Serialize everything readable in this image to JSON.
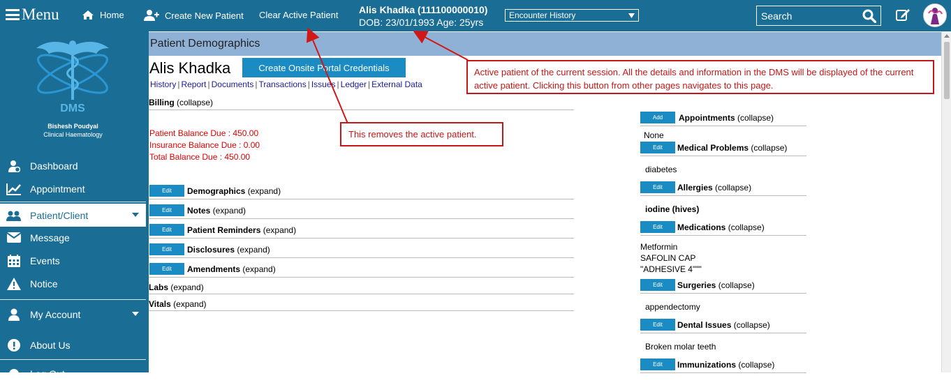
{
  "topbar": {
    "menu_label": "Menu",
    "home_label": "Home",
    "create_patient_label": "Create New Patient",
    "clear_patient_label": "Clear Active Patient",
    "patient_name": "Alis Khadka (111100000010)",
    "patient_dob_age": "DOB: 23/01/1993 Age: 25yrs",
    "encounter_select_value": "Encounter History",
    "search_placeholder": "Search",
    "colors": {
      "bar": "#1a6e95",
      "accent": "#1a8cc3"
    }
  },
  "sidebar": {
    "logo_text": "DMS",
    "doctor_name": "Bishesh Poudyal",
    "doctor_specialty": "Clinical Haematology",
    "items": [
      {
        "label": "Dashboard",
        "icon": "user-gauge-icon"
      },
      {
        "label": "Appointment",
        "icon": "line-chart-icon"
      },
      {
        "label": "Patient/Client",
        "icon": "users-icon"
      },
      {
        "label": "Message",
        "icon": "envelope-icon"
      },
      {
        "label": "Events",
        "icon": "calendar-icon"
      },
      {
        "label": "Notice",
        "icon": "warning-icon"
      },
      {
        "label": "My Account",
        "icon": "user-icon"
      },
      {
        "label": "About Us",
        "icon": "info-icon"
      }
    ],
    "partial_bottom_label": "Log Out"
  },
  "main": {
    "section_header": "Patient Demographics",
    "patient_name": "Alis Khadka",
    "portal_button": "Create Onsite Portal Credentials",
    "sublinks": [
      "History",
      "Report",
      "Documents",
      "Transactions",
      "Issues",
      "Ledger",
      "External Data"
    ],
    "billing": {
      "title": "Billing",
      "toggle": "(collapse)",
      "patient_balance": "Patient Balance Due : 450.00",
      "insurance_balance": "Insurance Balance Due : 0.00",
      "total_balance": "Total Balance Due : 450.00"
    },
    "edit_label": "Edit",
    "add_label": "Add",
    "expand_label": "(expand)",
    "collapse_label": "(collapse)",
    "left_sections": [
      "Demographics",
      "Notes",
      "Patient Reminders",
      "Disclosures",
      "Amendments"
    ],
    "labs_title": "Labs",
    "vitals_title": "Vitals",
    "right_sections": {
      "appointments": {
        "title": "Appointments",
        "content": "None"
      },
      "problems": {
        "title": "Medical Problems",
        "content": "diabetes"
      },
      "allergies": {
        "title": "Allergies",
        "content": "iodine (hives)"
      },
      "medications": {
        "title": "Medications",
        "content": [
          "Metformin",
          "SAFOLIN CAP",
          "\"ADHESIVE 4\"\"\""
        ]
      },
      "surgeries": {
        "title": "Surgeries",
        "content": "appendectomy"
      },
      "dental": {
        "title": "Dental Issues",
        "content": "Broken molar teeth"
      },
      "immunizations": {
        "title": "Immunizations"
      }
    }
  },
  "annotations": {
    "active_patient_note": "Active patient of the current session. All the details and information in the DMS will be displayed of the current active patient. Clicking this button from other pages navigates to this page.",
    "clear_patient_note": "This removes the active patient."
  }
}
